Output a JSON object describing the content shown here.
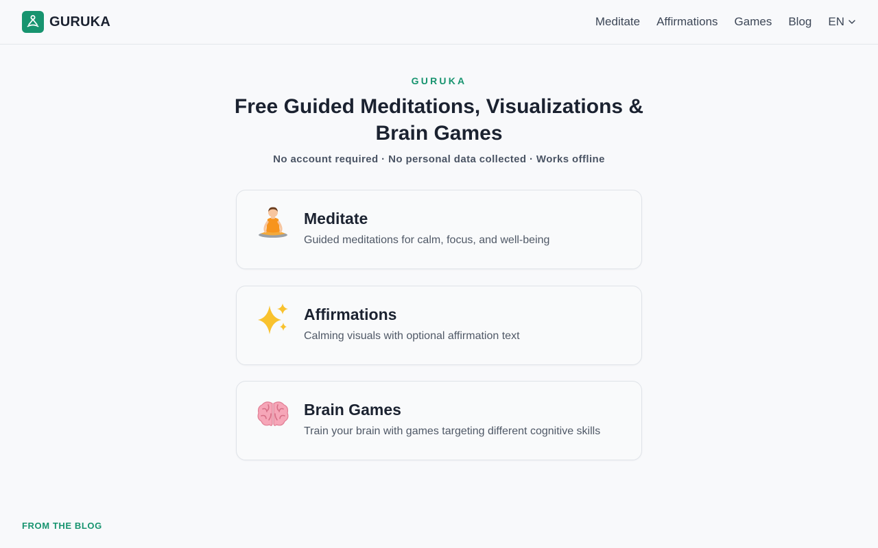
{
  "header": {
    "brand": "GURUKA",
    "logo_icon": "meditating-person-icon",
    "accent": "#17946f",
    "nav": [
      {
        "label": "Meditate"
      },
      {
        "label": "Affirmations"
      },
      {
        "label": "Games"
      },
      {
        "label": "Blog"
      }
    ],
    "language": "EN"
  },
  "hero": {
    "eyebrow": "GURUKA",
    "title": "Free Guided Meditations, Visualizations & Brain Games",
    "subtitle": "No account required · No personal data collected · Works offline"
  },
  "cards": [
    {
      "icon": "meditation-icon",
      "title": "Meditate",
      "description": "Guided meditations for calm, focus, and well-being"
    },
    {
      "icon": "sparkles-icon",
      "title": "Affirmations",
      "description": "Calming visuals with optional affirmation text"
    },
    {
      "icon": "brain-icon",
      "title": "Brain Games",
      "description": "Train your brain with games targeting different cognitive skills"
    }
  ],
  "blog": {
    "section_label": "FROM THE BLOG"
  }
}
